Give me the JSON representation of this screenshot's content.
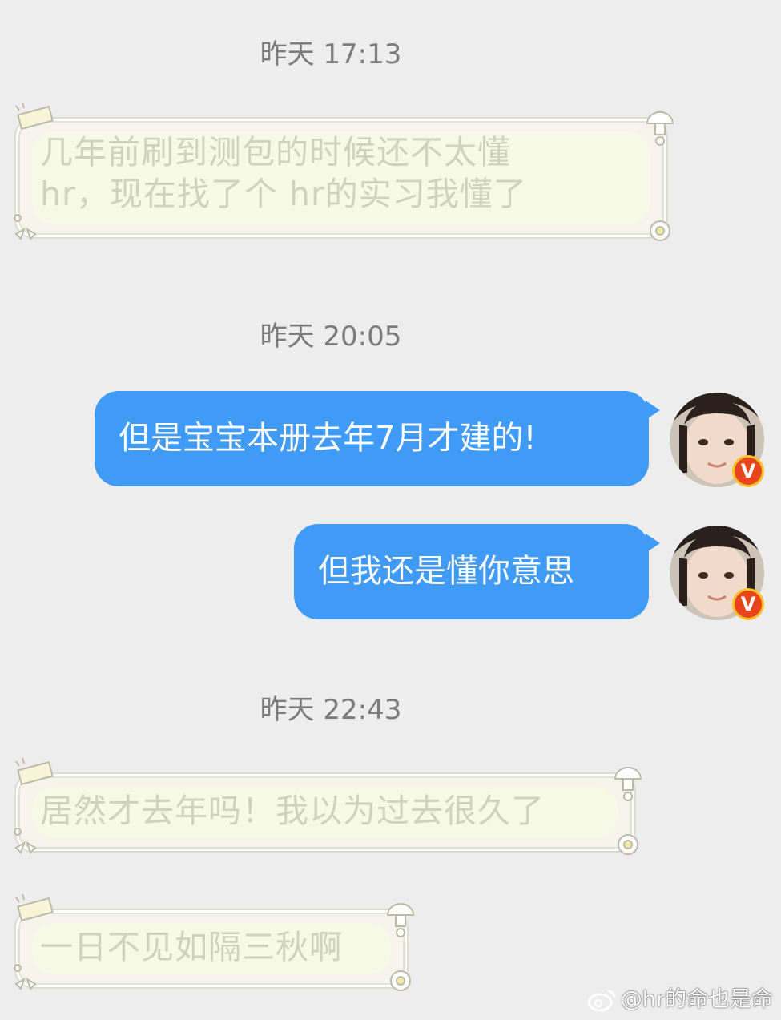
{
  "conversation": {
    "timestamps": [
      "昨天 17:13",
      "昨天 20:05",
      "昨天 22:43"
    ],
    "incoming": [
      {
        "text": "几年前刷到测包的时候还不太懂\nhr，现在找了个 hr的实习我懂了"
      },
      {
        "text": "居然才去年吗！我以为过去很久了"
      },
      {
        "text": "一日不见如隔三秋啊"
      }
    ],
    "outgoing": [
      {
        "text": "但是宝宝本册去年7月才建的!"
      },
      {
        "text": "但我还是懂你意思"
      }
    ],
    "avatar_badge": "V"
  },
  "watermark": {
    "icon": "weibo-icon",
    "text": "@hr的命也是命"
  },
  "colors": {
    "background": "#ededed",
    "outgoing_bubble": "#3f9bf5",
    "incoming_fill": "#f5f9e6",
    "incoming_text": "#cfd3bd",
    "badge": "#e8451c"
  }
}
